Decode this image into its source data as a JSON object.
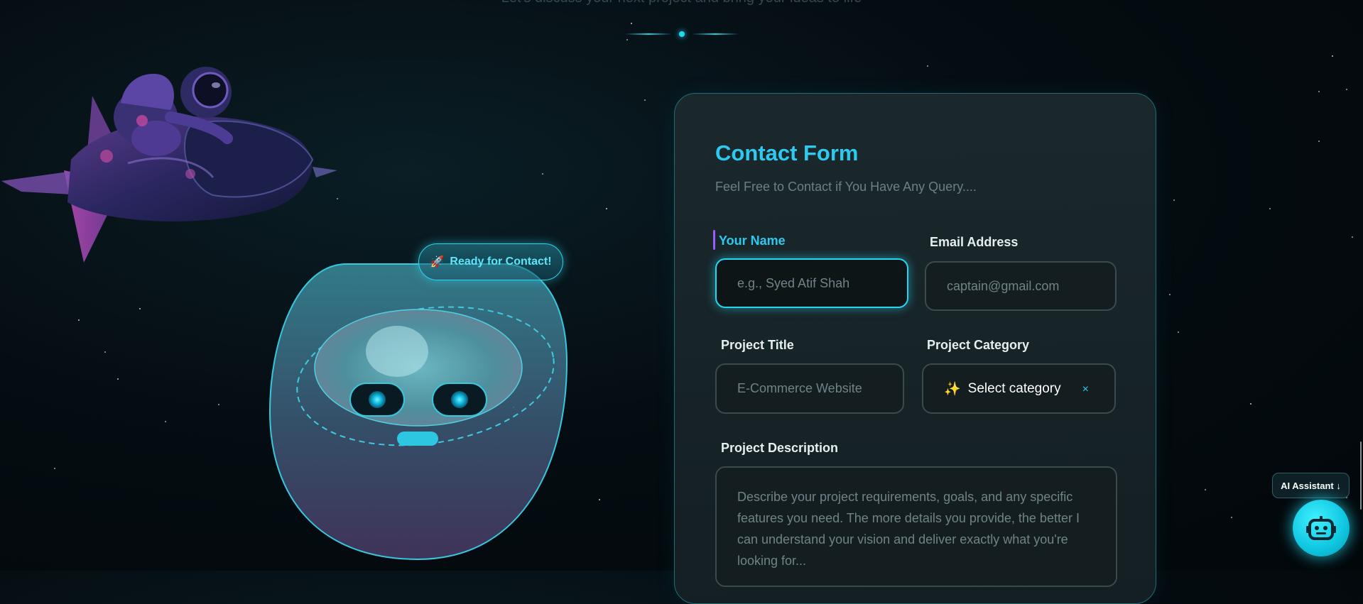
{
  "hero": {
    "tagline": "Let's discuss your next project and bring your ideas to life"
  },
  "robot": {
    "bubble_icon": "rocket-icon",
    "bubble_text": "Ready for Contact!"
  },
  "contact_form": {
    "title": "Contact Form",
    "subtitle": "Feel Free to Contact if You Have Any Query....",
    "name": {
      "label": "Your Name",
      "placeholder": "e.g., Syed Atif Shah",
      "value": ""
    },
    "email": {
      "label": "Email Address",
      "placeholder": "captain@gmail.com",
      "value": ""
    },
    "project_title": {
      "label": "Project Title",
      "placeholder": "E-Commerce Website",
      "value": ""
    },
    "project_category": {
      "label": "Project Category",
      "icon": "sparkles-icon",
      "selected": "Select category",
      "clear_icon": "×"
    },
    "project_description": {
      "label": "Project Description",
      "placeholder": "Describe your project requirements, goals, and any specific features you need. The more details you provide, the better I can understand your vision and deliver exactly what you're looking for..."
    }
  },
  "assistant": {
    "tag": "AI Assistant ↓",
    "button_icon": "robot-icon"
  },
  "colors": {
    "accent": "#2ec9ee",
    "focus_border": "#27d7f0",
    "card_border": "#1f6e77",
    "background": "#02070a"
  }
}
